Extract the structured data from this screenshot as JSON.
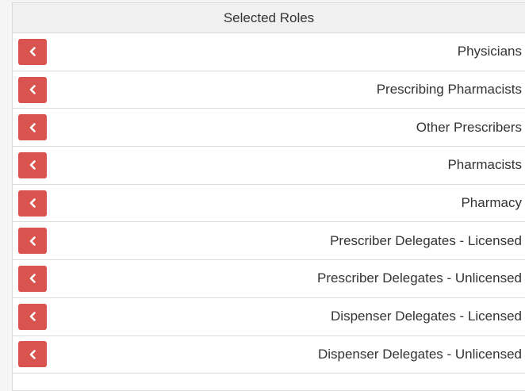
{
  "panel": {
    "title": "Selected Roles",
    "roles": [
      {
        "label": "Physicians"
      },
      {
        "label": "Prescribing Pharmacists"
      },
      {
        "label": "Other Prescribers"
      },
      {
        "label": "Pharmacists"
      },
      {
        "label": "Pharmacy"
      },
      {
        "label": "Prescriber Delegates - Licensed"
      },
      {
        "label": "Prescriber Delegates - Unlicensed"
      },
      {
        "label": "Dispenser Delegates - Licensed"
      },
      {
        "label": "Dispenser Delegates - Unlicensed"
      }
    ]
  },
  "icons": {
    "remove": "chevron-left-icon"
  },
  "colors": {
    "remove_button": "#d9534f",
    "header_bg": "#f0f0f0",
    "text": "#333333"
  }
}
